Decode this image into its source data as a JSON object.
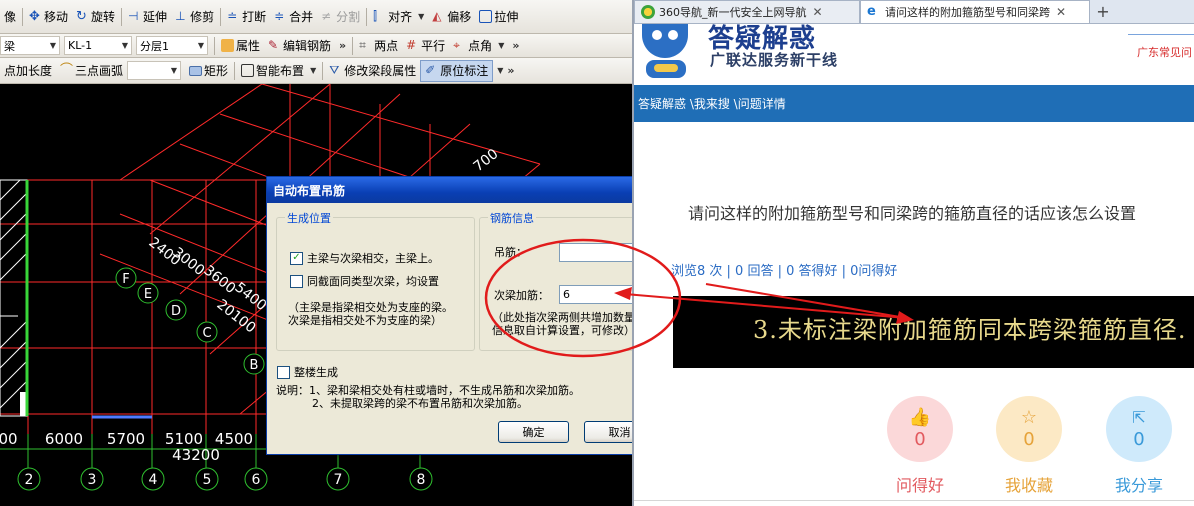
{
  "colors": {
    "accent": "#1f6eb6",
    "annotation": "#e11b1b",
    "cad_bg": "#000000",
    "grid_red": "#ff2a2a"
  },
  "cad": {
    "toolbar1": [
      {
        "label": "像",
        "icon": "image-icon",
        "disabled": false
      },
      {
        "label": "移动",
        "icon": "move-icon",
        "disabled": false
      },
      {
        "label": "旋转",
        "icon": "rotate-icon",
        "disabled": false
      },
      {
        "label": "延伸",
        "icon": "extend-icon",
        "disabled": false
      },
      {
        "label": "修剪",
        "icon": "trim-icon",
        "disabled": false
      },
      {
        "label": "打断",
        "icon": "break-icon",
        "disabled": false
      },
      {
        "label": "合并",
        "icon": "merge-icon",
        "disabled": false
      },
      {
        "label": "分割",
        "icon": "split-icon",
        "disabled": true
      },
      {
        "label": "对齐",
        "icon": "align-icon",
        "disabled": false
      },
      {
        "label": "偏移",
        "icon": "offset-icon",
        "disabled": false
      },
      {
        "label": "拉伸",
        "icon": "stretch-icon",
        "disabled": false
      }
    ],
    "toolbar2": {
      "combo1": "梁",
      "combo2": "KL-1",
      "combo3": "分层1",
      "items": [
        {
          "label": "属性",
          "icon": "property-icon"
        },
        {
          "label": "编辑钢筋",
          "icon": "edit-rebar-icon"
        },
        {
          "label": "两点",
          "icon": "two-point-icon"
        },
        {
          "label": "平行",
          "icon": "parallel-icon"
        },
        {
          "label": "点角",
          "icon": "point-angle-icon"
        }
      ]
    },
    "toolbar3": {
      "items": [
        {
          "label": "点加长度",
          "icon": ""
        },
        {
          "label": "三点画弧",
          "icon": "arc-icon"
        },
        {
          "label": "矩形",
          "icon": "rect-icon"
        },
        {
          "label": "智能布置",
          "icon": "smart-layout-icon"
        },
        {
          "label": "修改梁段属性",
          "icon": "modify-beam-icon"
        },
        {
          "label": "原位标注",
          "icon": "in-place-label-icon"
        }
      ]
    },
    "drawing": {
      "diagonal_labels": [
        "2400",
        "3000",
        "3600",
        "5400",
        "20100",
        "700"
      ],
      "axis_letters": [
        "F",
        "E",
        "D",
        "C",
        "B"
      ],
      "bottom_dims": [
        "00",
        "6000",
        "5700",
        "5100",
        "4500"
      ],
      "total_dim": "43200",
      "axis_numbers": [
        "2",
        "3",
        "4",
        "5",
        "6",
        "7",
        "8"
      ]
    },
    "dialog": {
      "title": "自动布置吊筋",
      "close": "✕",
      "group_position": "生成位置",
      "opt_main_secondary": "主梁与次梁相交，主梁上。",
      "opt_main_secondary_checked": true,
      "opt_same_section": "同截面同类型次梁，均设置",
      "opt_same_section_checked": false,
      "note_position_1": "（主梁是指梁相交处为支座的梁。",
      "note_position_2": "次梁是指相交处不为支座的梁）",
      "group_rebar": "钢筋信息",
      "hanger_label": "吊筋：",
      "hanger_value": "",
      "stirrup_label": "次梁加筋：",
      "stirrup_value": "6",
      "note_rebar_1": "（此处指次梁两侧共增加数量，",
      "note_rebar_2": "信息取自计算设置，可修改）",
      "whole_floor": "整楼生成",
      "whole_floor_checked": false,
      "explain_1": "说明：1、梁和梁相交处有柱或墙时，不生成吊筋和次梁加筋。",
      "explain_2": "2、未提取梁跨的梁不布置吊筋和次梁加筋。",
      "ok": "确定",
      "cancel": "取消"
    }
  },
  "browser": {
    "tabs": [
      {
        "label": "360导航_新一代安全上网导航",
        "icon": "browser-360-icon",
        "active": false
      },
      {
        "label": "请问这样的附加箍筋型号和同梁跨",
        "icon": "ie-icon",
        "active": true
      }
    ],
    "new_tab": "+",
    "site_title": "答疑解惑",
    "site_subtitle": "广联达服务新干线",
    "top_link": "广东常见问",
    "breadcrumb": "答疑解惑 \\我来搜 \\问题详情",
    "question_title": "请问这样的附加箍筋型号和同梁跨的箍筋直径的话应该怎么设置",
    "meta": "浏览8 次 | 0 回答 | 0 答得好 | 0问得好",
    "banner_text": "3.未标注梁附加箍筋同本跨梁箍筋直径.",
    "actions": [
      {
        "label": "问得好",
        "count": "0",
        "icon": "thumb-up-icon",
        "bg": "#fbd8d9",
        "fg": "#e25a5f"
      },
      {
        "label": "我收藏",
        "count": "0",
        "icon": "star-icon",
        "bg": "#fce9c5",
        "fg": "#e6a33a"
      },
      {
        "label": "我分享",
        "count": "0",
        "icon": "share-icon",
        "bg": "#cfeafb",
        "fg": "#3a9ad9"
      }
    ]
  }
}
